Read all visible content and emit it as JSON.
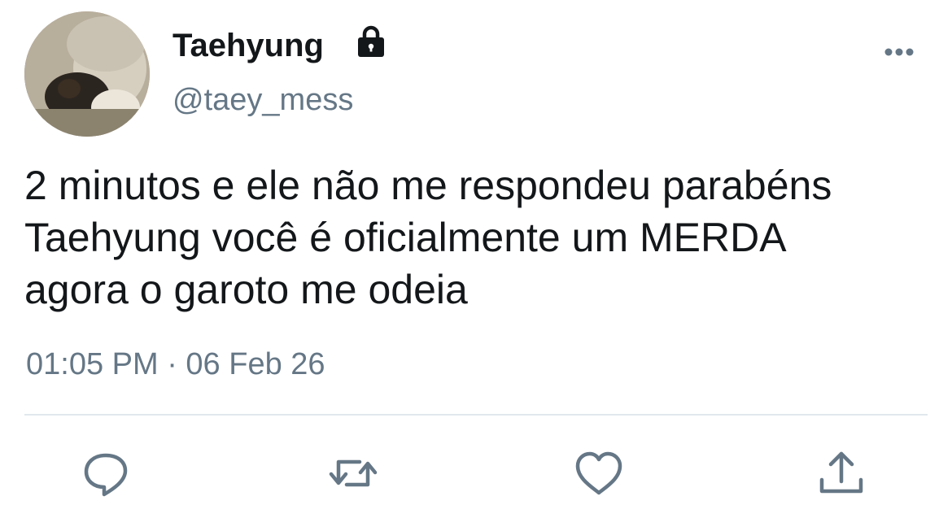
{
  "tweet": {
    "display_name": "Taehyung",
    "handle": "@taey_mess",
    "protected_icon": "lock-icon",
    "menu_icon": "more-horizontal-icon",
    "text_lines": [
      "2 minutos e ele não me respondeu parabéns",
      "Taehyung você é oficialmente um MERDA",
      "agora o garoto me odeia"
    ],
    "timestamp": "01:05 PM · 06 Feb 26"
  },
  "actions": [
    {
      "name": "reply",
      "icon": "reply-icon"
    },
    {
      "name": "retweet",
      "icon": "retweet-icon"
    },
    {
      "name": "like",
      "icon": "heart-icon"
    },
    {
      "name": "share",
      "icon": "share-icon"
    }
  ],
  "colors": {
    "text_primary": "#14171a",
    "text_secondary": "#657786",
    "icon": "#657786",
    "divider": "#e1e8ed",
    "background": "#ffffff"
  }
}
